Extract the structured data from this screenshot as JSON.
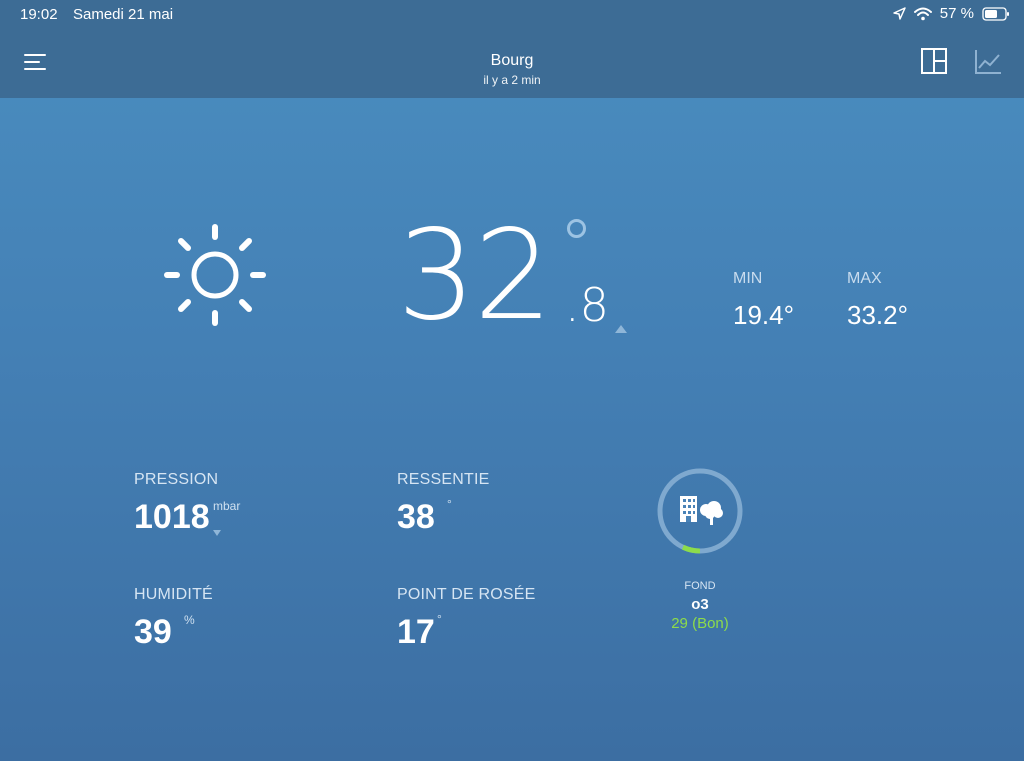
{
  "status_bar": {
    "time": "19:02",
    "date": "Samedi 21 mai",
    "battery": "57 %",
    "icons": [
      "location-arrow-icon",
      "wifi-icon",
      "battery-icon"
    ]
  },
  "header": {
    "title": "Bourg",
    "subtitle": "il y a 2 min",
    "left_icon": "menu-icon",
    "right_icons": [
      "layout-icon",
      "chart-icon"
    ]
  },
  "current": {
    "icon": "sun-icon",
    "temp_int": "32",
    "temp_dec": ".8",
    "trend": "up",
    "min_label": "MIN",
    "min_value": "19.4°",
    "max_label": "MAX",
    "max_value": "33.2°"
  },
  "stats": {
    "pressure": {
      "label": "PRESSION",
      "value": "1018",
      "unit": "mbar",
      "trend": "down"
    },
    "feels_like": {
      "label": "RESSENTIE",
      "value": "38",
      "unit": "°"
    },
    "humidity": {
      "label": "HUMIDITÉ",
      "value": "39",
      "unit": "%"
    },
    "dew_point": {
      "label": "POINT DE ROSÉE",
      "value": "17",
      "unit": "°"
    }
  },
  "air_quality": {
    "label": "FOND",
    "pollutant": "o3",
    "value": "29 (Bon)",
    "level": 0.07,
    "color": "#8ddc4a"
  },
  "colors": {
    "bar": "#3d6c95",
    "background_top": "#4a8ec0",
    "background_bottom": "#3c6ea2",
    "good": "#8ddc4a"
  }
}
